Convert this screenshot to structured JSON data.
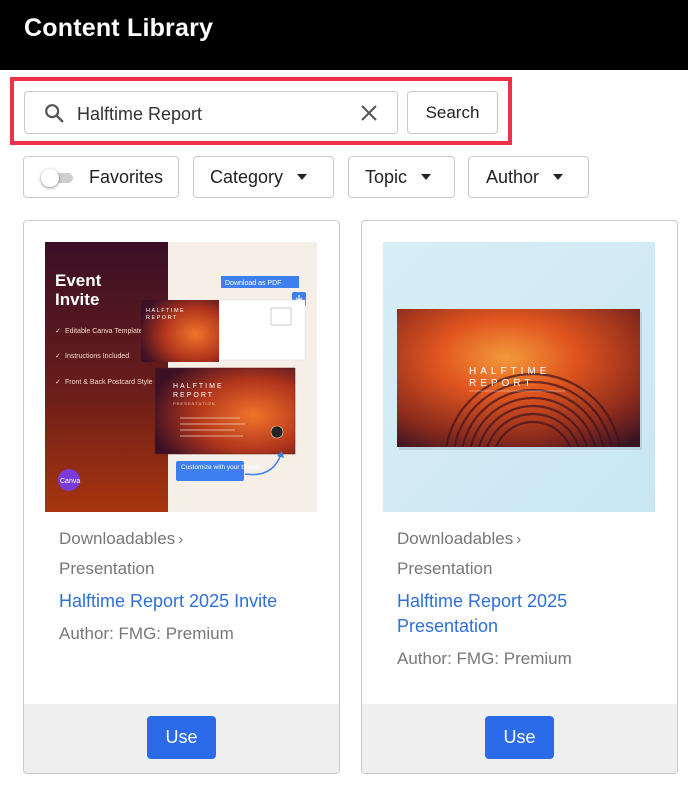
{
  "header": {
    "title": "Content Library"
  },
  "search": {
    "query": "Halftime Report",
    "button_label": "Search",
    "highlight_color": "#f0314a"
  },
  "filters": {
    "favorites_label": "Favorites",
    "favorites_on": false,
    "category_label": "Category",
    "topic_label": "Topic",
    "author_label": "Author"
  },
  "colors": {
    "link": "#2f6fd8",
    "primary_button": "#2b6ae8"
  },
  "cards": [
    {
      "breadcrumb": "Downloadables",
      "type": "Presentation",
      "title": "Halftime Report 2025 Invite",
      "author": "Author: FMG: Premium",
      "use_label": "Use",
      "thumbnail": {
        "heading_1": "Event",
        "heading_2": "Invite",
        "features": [
          "Editable Canva Template",
          "Instructions Included",
          "Front & Back Postcard Style"
        ],
        "download_label": "Download as PDF",
        "doc_title_1": "HALFTIME",
        "doc_title_2": "REPORT",
        "doc_subtitle": "PRESENTATION",
        "callout": "Customize with your brand",
        "canva_label": "Canva"
      }
    },
    {
      "breadcrumb": "Downloadables",
      "type": "Presentation",
      "title": "Halftime Report 2025 Presentation",
      "author": "Author: FMG: Premium",
      "use_label": "Use",
      "thumbnail": {
        "slide_title_1": "HALFTIME",
        "slide_title_2": "REPORT"
      }
    }
  ]
}
